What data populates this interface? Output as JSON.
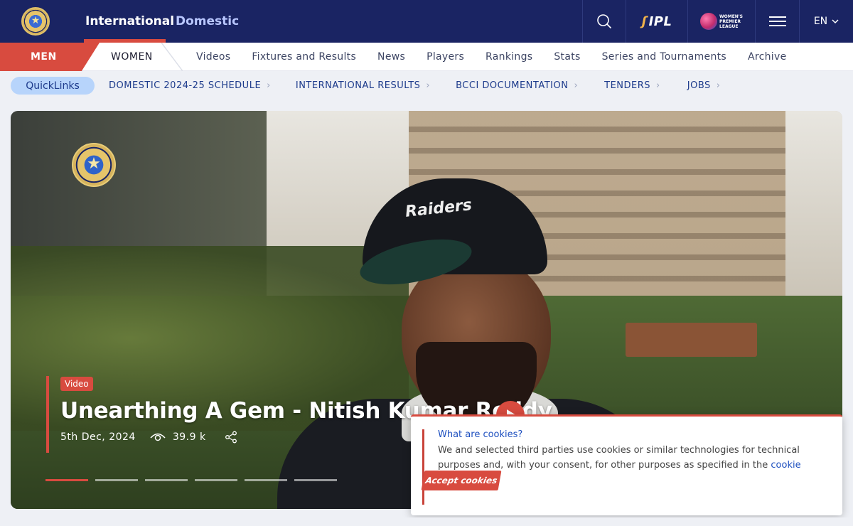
{
  "header": {
    "tabs": [
      {
        "label": "International"
      },
      {
        "label": "Domestic"
      }
    ],
    "ipl_logo": "IPL",
    "wpl_logo_lines": [
      "WOMEN'S",
      "PREMIER",
      "LEAGUE"
    ],
    "language": "EN",
    "icons": [
      "search-icon",
      "menu-icon",
      "chevron-down-icon"
    ]
  },
  "subnav": {
    "men": "MEN",
    "women": "WOMEN",
    "links": [
      "Videos",
      "Fixtures and Results",
      "News",
      "Players",
      "Rankings",
      "Stats",
      "Series and Tournaments",
      "Archive"
    ]
  },
  "quicklinks": {
    "label": "QuickLinks",
    "links": [
      "DOMESTIC 2024-25 SCHEDULE",
      "INTERNATIONAL RESULTS",
      "BCCI DOCUMENTATION",
      "TENDERS",
      "JOBS"
    ]
  },
  "hero": {
    "badge": "Video",
    "title": "Unearthing A Gem - Nitish Kumar Reddy",
    "cap_text": "Raiders",
    "date": "5th Dec, 2024",
    "views": "39.9 k",
    "slide_count": 6,
    "active_slide": 1,
    "accent_color": "#d84b3f"
  },
  "cookie": {
    "title": "What are cookies?",
    "text_before": "We and selected third parties use cookies or similar technologies for technical purposes and, with your consent, for other purposes as specified in the ",
    "link": "cookie policy",
    "text_after": ".",
    "accept": "Accept cookies"
  }
}
